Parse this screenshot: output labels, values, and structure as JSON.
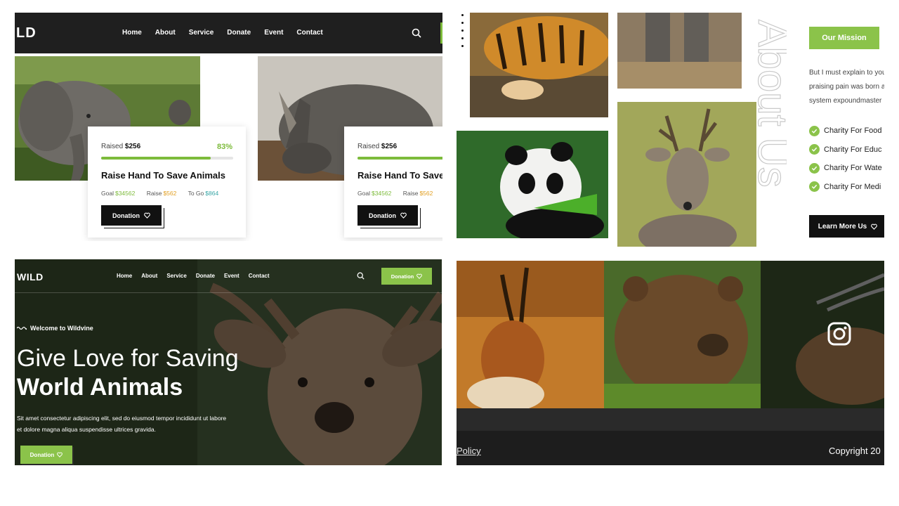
{
  "panel1": {
    "logo": "LD",
    "nav": [
      "Home",
      "About",
      "Service",
      "Donate",
      "Event",
      "Contact"
    ],
    "cards": [
      {
        "raised_label": "Raised",
        "raised_value": "$256",
        "percent": "83%",
        "progress": 0.83,
        "title": "Raise Hand To Save Animals",
        "goal_label": "Goal",
        "goal_value": "$34562",
        "raise_label": "Raise",
        "raise_value": "$562",
        "togo_label": "To Go",
        "togo_value": "$864",
        "button": "Donation"
      },
      {
        "raised_label": "Raised",
        "raised_value": "$256",
        "title": "Raise Hand To Save /",
        "goal_label": "Goal",
        "goal_value": "$34562",
        "raise_label": "Raise",
        "raise_value": "$562",
        "button": "Donation"
      }
    ]
  },
  "panel2": {
    "mission_button": "Our Mission",
    "paragraph": [
      "But I must explain to you",
      "praising pain was born a",
      "system expoundmaster"
    ],
    "charity_items": [
      "Charity For Food",
      "Charity For Educ",
      "Charity For Wate",
      "Charity For Medi"
    ],
    "learn_button": "Learn More Us",
    "vertical_text": "About Us"
  },
  "panel3": {
    "logo": "WILD",
    "nav": [
      "Home",
      "About",
      "Service",
      "Donate",
      "Event",
      "Contact"
    ],
    "donation_button": "Donation",
    "welcome": "Welcome to Wildvine",
    "heading_line1": "Give Love for Saving",
    "heading_line2": "World Animals",
    "subtitle": "Sit amet consectetur adipiscing elit, sed do eiusmod tempor incididunt ut labore et dolore magna aliqua suspendisse ultrices gravida.",
    "cta_button": "Donation"
  },
  "panel4": {
    "policy": "Policy",
    "copyright": "Copyright 20"
  },
  "colors": {
    "accent_green": "#8bc34a",
    "dark": "#1f1f1f",
    "orange": "#e2a024",
    "teal": "#3aa7a7"
  }
}
